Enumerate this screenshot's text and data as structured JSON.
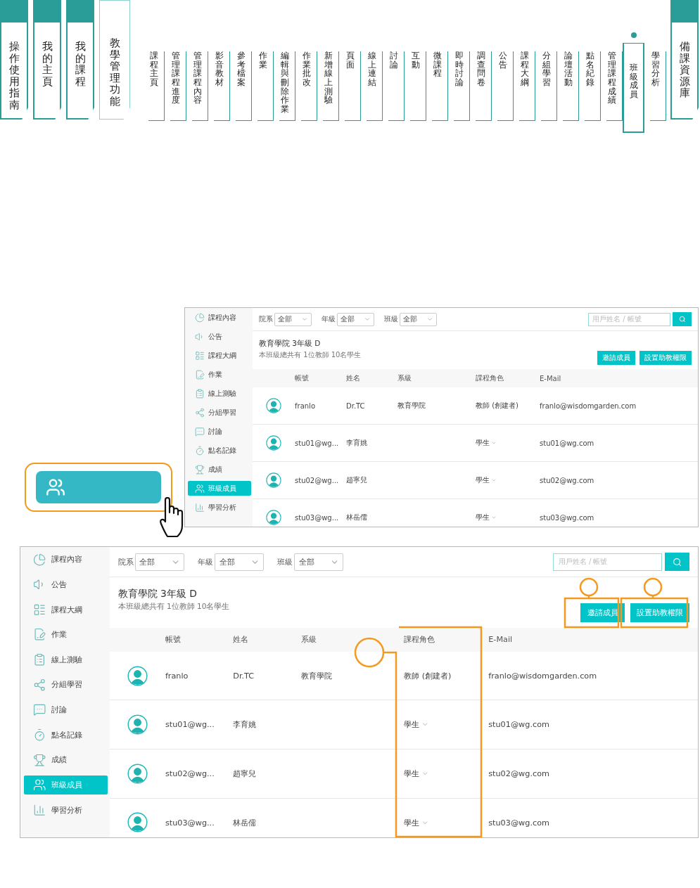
{
  "nav": {
    "sections": [
      {
        "label": "操作使用指南",
        "selected": false
      },
      {
        "label": "我的主頁",
        "selected": false
      },
      {
        "label": "我的課程",
        "selected": false
      },
      {
        "label": "教學管理功能",
        "selected": true
      }
    ],
    "items": [
      {
        "label": "課程主頁",
        "selected": false
      },
      {
        "label": "管理課程進度",
        "selected": false
      },
      {
        "label": "管理課程內容",
        "selected": false
      },
      {
        "label": "影音教材",
        "selected": false
      },
      {
        "label": "參考檔案",
        "selected": false
      },
      {
        "label": "作業",
        "selected": false
      },
      {
        "label": "編輯與刪除作業",
        "selected": false
      },
      {
        "label": "作業批改",
        "selected": false
      },
      {
        "label": "新增線上測驗",
        "selected": false
      },
      {
        "label": "頁面",
        "selected": false
      },
      {
        "label": "線上連結",
        "selected": false
      },
      {
        "label": "討論",
        "selected": false
      },
      {
        "label": "互動",
        "selected": false
      },
      {
        "label": "微課程",
        "selected": false
      },
      {
        "label": "即時討論",
        "selected": false
      },
      {
        "label": "調查問卷",
        "selected": false
      },
      {
        "label": "公告",
        "selected": false
      },
      {
        "label": "課程大綱",
        "selected": false
      },
      {
        "label": "分組學習",
        "selected": false
      },
      {
        "label": "論壇活動",
        "selected": false
      },
      {
        "label": "點名紀錄",
        "selected": false
      },
      {
        "label": "管理課程成績",
        "selected": false
      },
      {
        "label": "班級成員",
        "selected": true
      },
      {
        "label": "學習分析",
        "selected": false
      }
    ],
    "end_section": {
      "label": "備課資源庫",
      "selected": false
    }
  },
  "screens": [
    {
      "sidebar": [
        {
          "label": "課程內容",
          "selected": false
        },
        {
          "label": "公告",
          "selected": false
        },
        {
          "label": "課程大綱",
          "selected": false
        },
        {
          "label": "作業",
          "selected": false
        },
        {
          "label": "線上測驗",
          "selected": false
        },
        {
          "label": "分組學習",
          "selected": false
        },
        {
          "label": "討論",
          "selected": false
        },
        {
          "label": "點名記錄",
          "selected": false
        },
        {
          "label": "成績",
          "selected": false
        },
        {
          "label": "班級成員",
          "selected": true
        },
        {
          "label": "學習分析",
          "selected": false
        }
      ],
      "filters": [
        {
          "label": "院系",
          "value": "全部"
        },
        {
          "label": "年級",
          "value": "全部"
        },
        {
          "label": "班級",
          "value": "全部"
        }
      ],
      "search": {
        "placeholder": "用戶姓名 / 帳號"
      },
      "title": "教育學院 3年級 D",
      "summary": "本班級總共有 1位教師 10名學生",
      "buttons": [
        "邀請成員",
        "設置助教權限"
      ],
      "columns": [
        "帳號",
        "姓名",
        "系級",
        "課程角色",
        "E-Mail"
      ],
      "rows": [
        {
          "account": "franlo",
          "name": "Dr.TC",
          "dept": "教育學院",
          "role": "教師 (創建者)",
          "role_dropdown": false,
          "email": "franlo@wisdomgarden.com"
        },
        {
          "account": "stu01@wg...",
          "name": "李育姚",
          "role": "學生",
          "role_dropdown": true,
          "email": "stu01@wg.com"
        },
        {
          "account": "stu02@wg...",
          "name": "趙寧兒",
          "role": "學生",
          "role_dropdown": true,
          "email": "stu02@wg.com"
        },
        {
          "account": "stu03@wg...",
          "name": "林岳儒",
          "role": "學生",
          "role_dropdown": true,
          "email": "stu03@wg.com"
        }
      ]
    },
    {
      "sidebar": [
        {
          "label": "課程內容",
          "selected": false
        },
        {
          "label": "公告",
          "selected": false
        },
        {
          "label": "課程大綱",
          "selected": false
        },
        {
          "label": "作業",
          "selected": false
        },
        {
          "label": "線上測驗",
          "selected": false
        },
        {
          "label": "分組學習",
          "selected": false
        },
        {
          "label": "討論",
          "selected": false
        },
        {
          "label": "點名記錄",
          "selected": false
        },
        {
          "label": "成績",
          "selected": false
        },
        {
          "label": "班級成員",
          "selected": true
        },
        {
          "label": "學習分析",
          "selected": false
        }
      ],
      "filters": [
        {
          "label": "院系",
          "value": "全部"
        },
        {
          "label": "年級",
          "value": "全部"
        },
        {
          "label": "班級",
          "value": "全部"
        }
      ],
      "search": {
        "placeholder": "用戶姓名 / 帳號"
      },
      "title": "教育學院 3年級 D",
      "summary": "本班級總共有 1位教師 10名學生",
      "buttons": [
        "邀請成員",
        "設置助教權限"
      ],
      "columns": [
        "帳號",
        "姓名",
        "系級",
        "課程角色",
        "E-Mail"
      ],
      "rows": [
        {
          "account": "franlo",
          "name": "Dr.TC",
          "dept": "教育學院",
          "role": "教師 (創建者)",
          "role_dropdown": false,
          "email": "franlo@wisdomgarden.com"
        },
        {
          "account": "stu01@wg...",
          "name": "李育姚",
          "role": "學生",
          "role_dropdown": true,
          "email": "stu01@wg.com"
        },
        {
          "account": "stu02@wg...",
          "name": "趙寧兒",
          "role": "學生",
          "role_dropdown": true,
          "email": "stu02@wg.com"
        },
        {
          "account": "stu03@wg...",
          "name": "林岳儒",
          "role": "學生",
          "role_dropdown": true,
          "email": "stu03@wg.com"
        }
      ]
    }
  ]
}
